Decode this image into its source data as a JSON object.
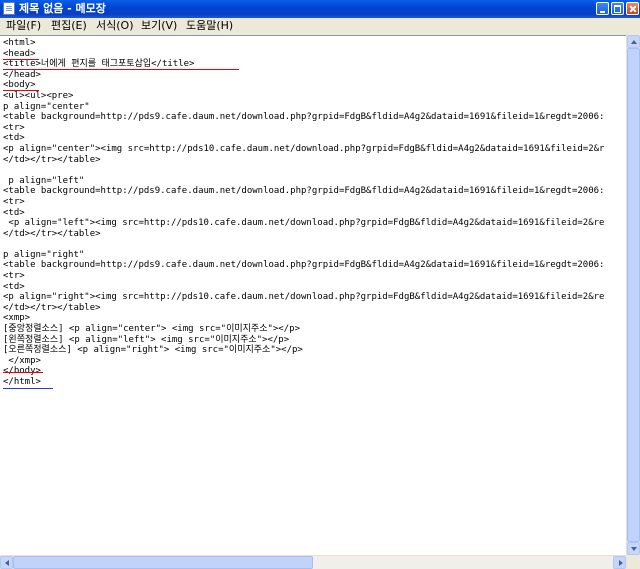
{
  "window": {
    "title": "제목 없음 - 메모장"
  },
  "menu": [
    {
      "label": "파일(F)"
    },
    {
      "label": "편집(E)"
    },
    {
      "label": "서식(O)"
    },
    {
      "label": "보기(V)"
    },
    {
      "label": "도움말(H)"
    }
  ],
  "editor": {
    "lines": [
      "<html>",
      "<head>",
      "<title>너에게 편지를 태그포토삽입</title>",
      "</head>",
      "<body>",
      "<ul><ul><pre>",
      "p align=\"center\"",
      "<table background=http://pds9.cafe.daum.net/download.php?grpid=FdgB&fldid=A4g2&dataid=1691&fileid=1&regdt=2006:",
      "<tr>",
      "<td>",
      "<p align=\"center\"><img src=http://pds10.cafe.daum.net/download.php?grpid=FdgB&fldid=A4g2&dataid=1691&fileid=2&r",
      "</td></tr></table>",
      "",
      " p align=\"left\"",
      "<table background=http://pds9.cafe.daum.net/download.php?grpid=FdgB&fldid=A4g2&dataid=1691&fileid=1&regdt=2006:",
      "<tr>",
      "<td>",
      " <p align=\"left\"><img src=http://pds10.cafe.daum.net/download.php?grpid=FdgB&fldid=A4g2&dataid=1691&fileid=2&re",
      "</td></tr></table>",
      "",
      "p align=\"right\"",
      "<table background=http://pds9.cafe.daum.net/download.php?grpid=FdgB&fldid=A4g2&dataid=1691&fileid=1&regdt=2006:",
      "<tr>",
      "<td>",
      "<p align=\"right\"><img src=http://pds10.cafe.daum.net/download.php?grpid=FdgB&fldid=A4g2&dataid=1691&fileid=2&re",
      "</td></tr></table>",
      "<xmp>",
      "[중앙정렬소스] <p align=\"center\"> <img src=\"이미지주소\"></p>",
      "[왼쪽정렬소스] <p align=\"left\"> <img src=\"이미지주소\"></p>",
      "[오른쪽정렬소스] <p align=\"right\"> <img src=\"이미지주소\"></p>",
      " </xmp>",
      "</body>",
      "</html>"
    ]
  },
  "colors": {
    "annotation_red": "#e8000c",
    "annotation_blue": "#1f3fd0"
  }
}
